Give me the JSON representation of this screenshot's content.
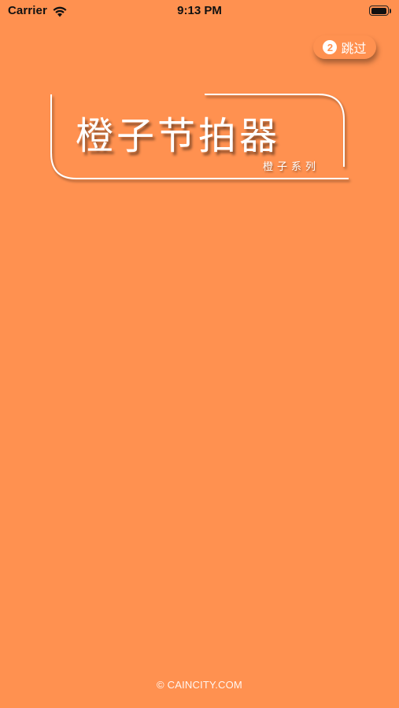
{
  "status_bar": {
    "carrier": "Carrier",
    "time": "9:13 PM"
  },
  "skip": {
    "countdown": "2",
    "label": "跳过"
  },
  "logo": {
    "title": "橙子节拍器",
    "subtitle": "橙子系列"
  },
  "footer": {
    "copyright": "© CAINCITY.COM"
  },
  "colors": {
    "background": "#FF9150",
    "text": "#FFFFFF"
  },
  "icons": [
    "wifi-icon",
    "battery-icon"
  ]
}
